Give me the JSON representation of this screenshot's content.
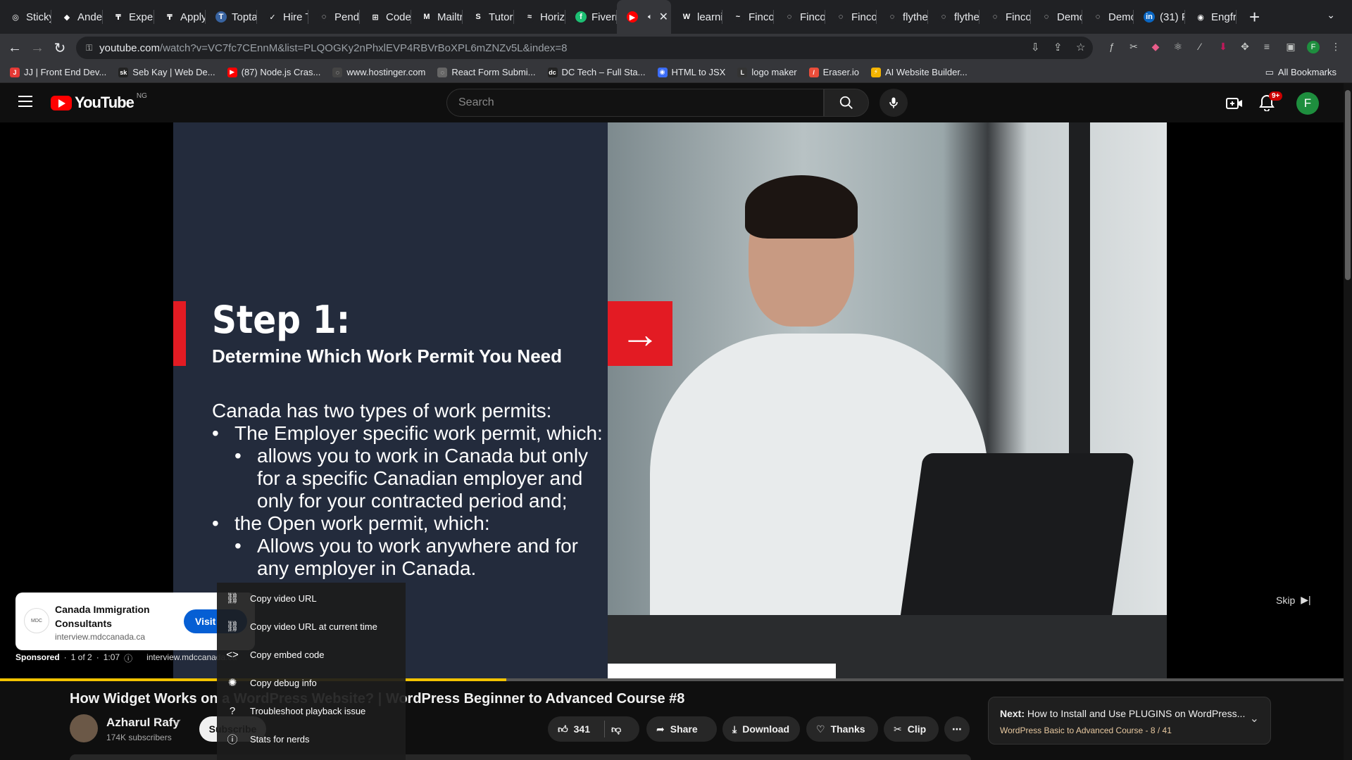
{
  "tabs": [
    {
      "label": "Sticky",
      "color": "#202124",
      "glyph": "◎"
    },
    {
      "label": "Andel",
      "color": "#202124",
      "glyph": "◆"
    },
    {
      "label": "Expert",
      "color": "#202124",
      "glyph": "₸"
    },
    {
      "label": "Apply",
      "color": "#202124",
      "glyph": "₸"
    },
    {
      "label": "Toptal",
      "color": "#3863a0",
      "glyph": "T"
    },
    {
      "label": "Hire T",
      "color": "#202124",
      "glyph": "✓"
    },
    {
      "label": "Pendi",
      "color": "#202124",
      "glyph": "◌"
    },
    {
      "label": "Coder",
      "color": "#202124",
      "glyph": "⊞"
    },
    {
      "label": "Mailtr",
      "color": "#202124",
      "glyph": "M"
    },
    {
      "label": "Tutori",
      "color": "#202124",
      "glyph": "S"
    },
    {
      "label": "Horizo",
      "color": "#202124",
      "glyph": "≈"
    },
    {
      "label": "Fiverr",
      "color": "#1dbf73",
      "glyph": "f"
    },
    {
      "label": "",
      "color": "#ff0000",
      "glyph": "▶",
      "active": true
    },
    {
      "label": "learni",
      "color": "#202124",
      "glyph": "W"
    },
    {
      "label": "Fincor",
      "color": "#202124",
      "glyph": "~"
    },
    {
      "label": "Fincor",
      "color": "#202124",
      "glyph": "◌"
    },
    {
      "label": "Fincor",
      "color": "#202124",
      "glyph": "◌"
    },
    {
      "label": "flythe",
      "color": "#202124",
      "glyph": "◌"
    },
    {
      "label": "flythe",
      "color": "#202124",
      "glyph": "◌"
    },
    {
      "label": "Fincor",
      "color": "#202124",
      "glyph": "◌"
    },
    {
      "label": "Demo",
      "color": "#202124",
      "glyph": "◌"
    },
    {
      "label": "Demo",
      "color": "#202124",
      "glyph": "◌"
    },
    {
      "label": "(31) F",
      "color": "#0a66c2",
      "glyph": "in"
    },
    {
      "label": "Engfr",
      "color": "#202124",
      "glyph": "◉"
    }
  ],
  "address": {
    "host": "youtube.com",
    "path": "/watch?v=VC7fc7CEnnM&list=PLQOGKy2nPhxlEVP4RBVrBoXPL6mZNZv5L&index=8"
  },
  "profile_initial": "F",
  "bookmarks": [
    {
      "label": "JJ | Front End Dev...",
      "color": "#e53935",
      "glyph": "J"
    },
    {
      "label": "Seb Kay | Web De...",
      "color": "#222",
      "glyph": "sk"
    },
    {
      "label": "(87) Node.js Cras...",
      "color": "#ff0000",
      "glyph": "▶"
    },
    {
      "label": "www.hostinger.com",
      "color": "#444",
      "glyph": "◌"
    },
    {
      "label": "React Form Submi...",
      "color": "#666",
      "glyph": "◌"
    },
    {
      "label": "DC Tech – Full Sta...",
      "color": "#222",
      "glyph": "dc"
    },
    {
      "label": "HTML to JSX",
      "color": "#3b6cf6",
      "glyph": "◉"
    },
    {
      "label": "logo maker",
      "color": "#333",
      "glyph": "L"
    },
    {
      "label": "Eraser.io",
      "color": "#e94d3a",
      "glyph": "/"
    },
    {
      "label": "AI Website Builder...",
      "color": "#f4b400",
      "glyph": "⚡"
    }
  ],
  "all_bookmarks": "All Bookmarks",
  "youtube": {
    "logo_text": "YouTube",
    "country": "NG",
    "search_placeholder": "Search",
    "notif_badge": "9+",
    "avatar_initial": "F"
  },
  "slide": {
    "step": "Step 1:",
    "subhead": "Determine Which Work Permit You Need",
    "intro": "Canada has two types of work permits:",
    "b1": "The Employer specific work permit, which:",
    "b1a": "allows you to work in Canada but only for a specific Canadian employer and only for your contracted period and;",
    "b2": "the Open work permit, which:",
    "b2a": "Allows you to work anywhere and for any employer in Canada."
  },
  "ad": {
    "title": "Canada Immigration Consultants",
    "domain": "interview.mdccanada.ca",
    "visit": "Visit",
    "logo_text": "MDC",
    "sponsored": "Sponsored",
    "count": "1 of 2",
    "time": "1:07",
    "meta_domain": "interview.mdccanada.ca",
    "skip": "Skip"
  },
  "progress_fraction": 0.377,
  "context_menu": [
    {
      "label": "Copy video URL",
      "icon": "link-icon",
      "glyph": "⛓"
    },
    {
      "label": "Copy video URL at current time",
      "icon": "link-icon",
      "glyph": "⛓"
    },
    {
      "label": "Copy embed code",
      "icon": "code-icon",
      "glyph": "<>"
    },
    {
      "label": "Copy debug info",
      "icon": "bug-icon",
      "glyph": "✺"
    },
    {
      "label": "Troubleshoot playback issue",
      "icon": "help-icon",
      "glyph": "?"
    },
    {
      "label": "Stats for nerds",
      "icon": "info-icon",
      "glyph": "ⓘ"
    }
  ],
  "video": {
    "title": "How Widget Works on a WordPress Website? | WordPress Beginner to Advanced Course #8",
    "channel": "Azharul Rafy",
    "subscribers": "174K subscribers",
    "subscribe": "Subscribe",
    "likes": "341",
    "share": "Share",
    "download": "Download",
    "thanks": "Thanks",
    "clip": "Clip"
  },
  "next": {
    "prefix": "Next:",
    "title": "How to Install and Use PLUGINS on WordPress...",
    "sub": "WordPress Basic to Advanced Course - 8 / 41"
  }
}
